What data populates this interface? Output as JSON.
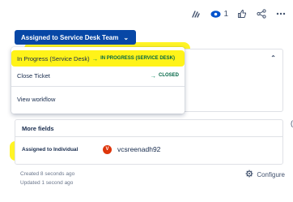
{
  "actions": {
    "watch_count": "1"
  },
  "status_button": {
    "label": "Assigned to Service Desk Team",
    "chevron": "⌄"
  },
  "transitions": {
    "items": [
      {
        "name": "In Progress (Service Desk)",
        "arrow": "→",
        "target": "IN PROGRESS (SERVICE DESK)"
      },
      {
        "name": "Close Ticket",
        "arrow": "→",
        "target": "CLOSED"
      }
    ],
    "view_workflow": "View workflow"
  },
  "more_fields": {
    "title": "More fields",
    "assigned_label": "Assigned to Individual",
    "assignee_initial": "V",
    "assignee_name": "vcsreenadh92"
  },
  "meta": {
    "created": "Created 8 seconds ago",
    "updated": "Updated 1 second ago"
  },
  "configure": {
    "label": "Configure"
  },
  "colors": {
    "primary": "#0747a6",
    "success": "#00875a",
    "avatar": "#de350b",
    "highlight": "#fff200"
  }
}
